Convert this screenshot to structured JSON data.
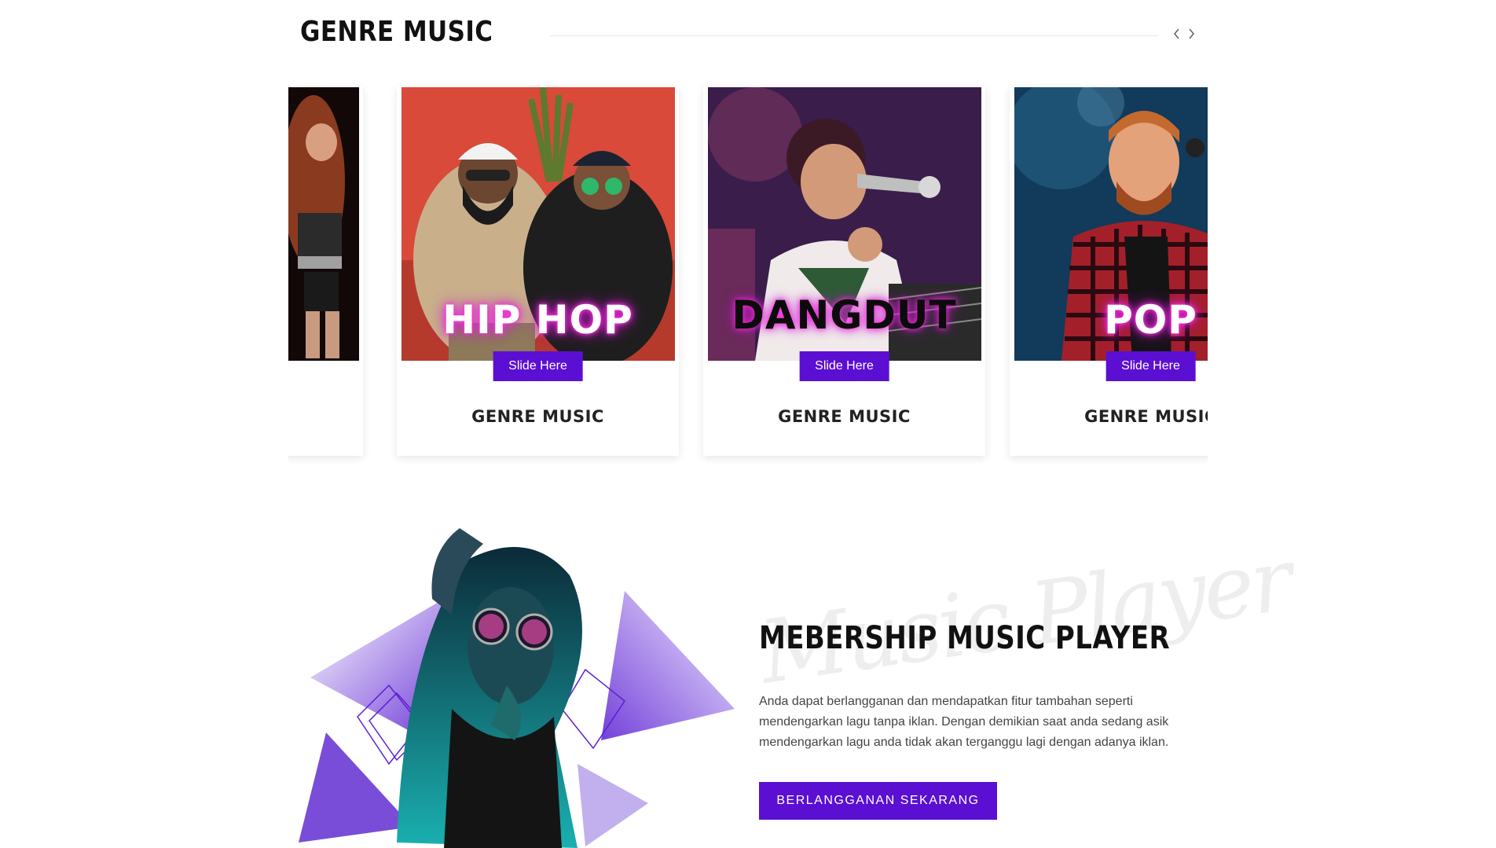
{
  "section": {
    "title": "GENRE MUSIC"
  },
  "cards": [
    {
      "genre": "",
      "slide_label": "",
      "caption": ""
    },
    {
      "genre": "HIP HOP",
      "slide_label": "Slide Here",
      "caption": "GENRE MUSIC"
    },
    {
      "genre": "DANGDUT",
      "slide_label": "Slide Here",
      "caption": "GENRE MUSIC"
    },
    {
      "genre": "POP",
      "slide_label": "Slide Here",
      "caption": "GENRE MUSIC"
    }
  ],
  "nav": {
    "prev_icon": "chevron-left-icon",
    "next_icon": "chevron-right-icon"
  },
  "membership": {
    "script_text": "Music Player",
    "title": "MEBERSHIP MUSIC PLAYER",
    "description": "Anda dapat berlangganan dan mendapatkan fitur tambahan seperti mendengarkan lagu tanpa iklan. Dengan demikian saat anda sedang asik mendengarkan lagu anda tidak akan terganggu lagi dengan adanya iklan.",
    "cta": "BERLANGGANAN SEKARANG"
  },
  "colors": {
    "accent": "#5b0fd3",
    "neon": "#ff2ddc"
  }
}
